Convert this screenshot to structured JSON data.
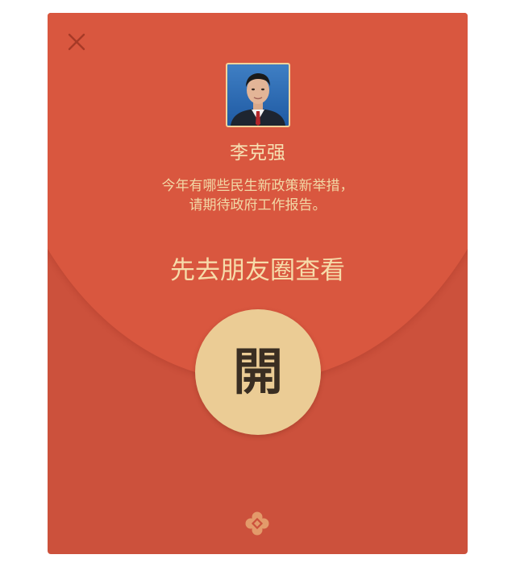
{
  "envelope": {
    "sender_name": "李克强",
    "wish_line_1": "今年有哪些民生新政策新举措，",
    "wish_line_2": "请期待政府工作报告。",
    "action_link": "先去朋友圈查看",
    "open_button": "開",
    "close_icon": "close-icon",
    "logo_icon": "red-packet-logo-icon"
  },
  "colors": {
    "envelope_bg": "#cc513c",
    "flap_bg": "#d9573f",
    "text_gold": "#f6dcaa",
    "button_gold": "#ebcc95",
    "button_text": "#3a2e22"
  }
}
